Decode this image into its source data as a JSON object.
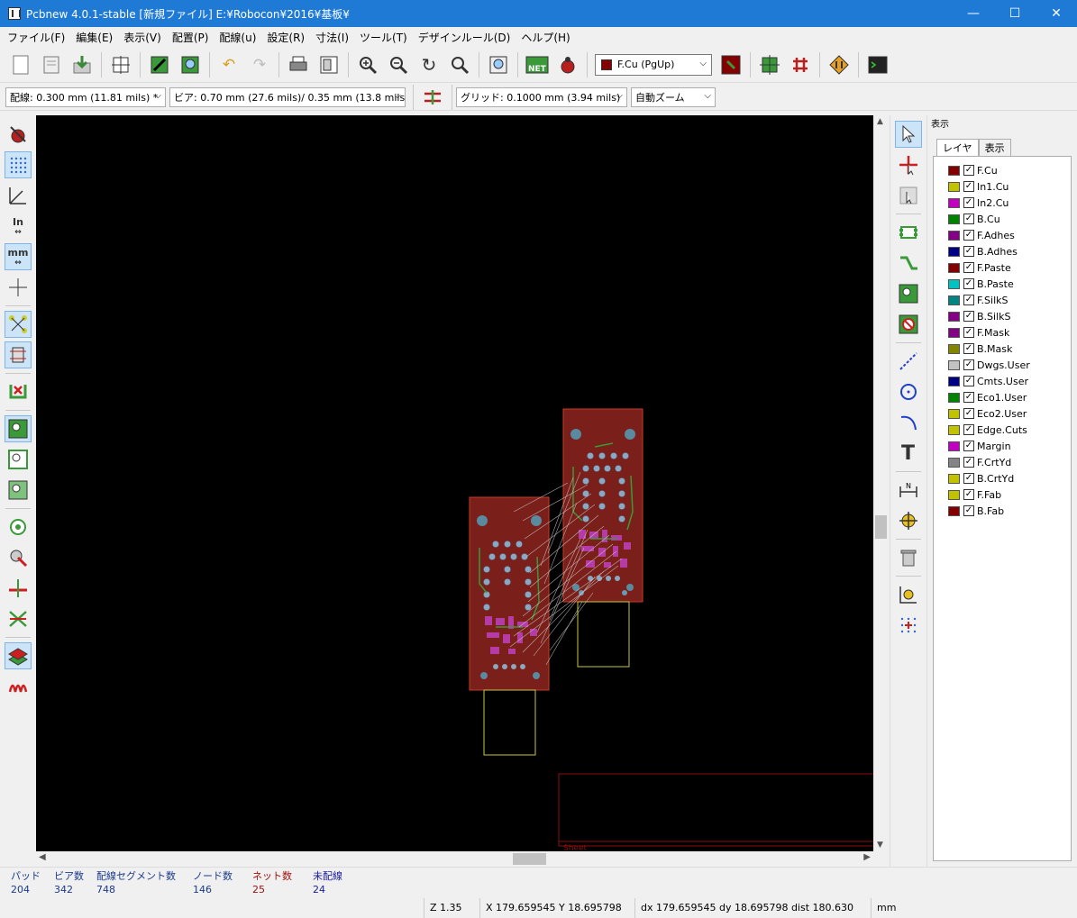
{
  "window": {
    "title": "Pcbnew 4.0.1-stable  [新規ファイル] E:¥Robocon¥2016¥基板¥",
    "minimize": "—",
    "maximize": "☐",
    "close": "✕"
  },
  "menu": [
    "ファイル(F)",
    "編集(E)",
    "表示(V)",
    "配置(P)",
    "配線(u)",
    "設定(R)",
    "寸法(I)",
    "ツール(T)",
    "デザインルール(D)",
    "ヘルプ(H)"
  ],
  "toolbar": {
    "active_layer": "F.Cu (PgUp)",
    "active_layer_color": "#840000"
  },
  "options": {
    "track_width": "配線: 0.300 mm (11.81 mils) *",
    "via_size": "ビア: 0.70 mm (27.6 mils)/ 0.35 mm (13.8 mils) *",
    "grid": "グリッド: 0.1000 mm (3.94 mils)",
    "zoom": "自動ズーム"
  },
  "left_toolbar": {
    "inch_label": "In",
    "mm_label": "mm"
  },
  "canvas": {
    "sheet_label": "Sheet"
  },
  "panel": {
    "title": "表示",
    "tabs": [
      "レイヤ",
      "表示"
    ],
    "layers": [
      {
        "name": "F.Cu",
        "color": "#840000"
      },
      {
        "name": "In1.Cu",
        "color": "#c2c200"
      },
      {
        "name": "In2.Cu",
        "color": "#c200c2"
      },
      {
        "name": "B.Cu",
        "color": "#008400"
      },
      {
        "name": "F.Adhes",
        "color": "#840084"
      },
      {
        "name": "B.Adhes",
        "color": "#000084"
      },
      {
        "name": "F.Paste",
        "color": "#840000"
      },
      {
        "name": "B.Paste",
        "color": "#00c2c2"
      },
      {
        "name": "F.SilkS",
        "color": "#008484"
      },
      {
        "name": "B.SilkS",
        "color": "#840084"
      },
      {
        "name": "F.Mask",
        "color": "#840084"
      },
      {
        "name": "B.Mask",
        "color": "#848400"
      },
      {
        "name": "Dwgs.User",
        "color": "#c2c2c2"
      },
      {
        "name": "Cmts.User",
        "color": "#000084"
      },
      {
        "name": "Eco1.User",
        "color": "#008400"
      },
      {
        "name": "Eco2.User",
        "color": "#c2c200"
      },
      {
        "name": "Edge.Cuts",
        "color": "#c2c200"
      },
      {
        "name": "Margin",
        "color": "#c200c2"
      },
      {
        "name": "F.CrtYd",
        "color": "#848484"
      },
      {
        "name": "B.CrtYd",
        "color": "#c2c200"
      },
      {
        "name": "F.Fab",
        "color": "#c2c200"
      },
      {
        "name": "B.Fab",
        "color": "#840000"
      }
    ]
  },
  "status": {
    "pads_label": "パッド",
    "pads": "204",
    "vias_label": "ビア数",
    "vias": "342",
    "segments_label": "配線セグメント数",
    "segments": "748",
    "nodes_label": "ノード数",
    "nodes": "146",
    "nets_label": "ネット数",
    "nets": "25",
    "unrouted_label": "未配線",
    "unrouted": "24",
    "zoom": "Z 1.35",
    "xy": "X 179.659545  Y 18.695798",
    "dxy": "dx 179.659545  dy 18.695798  dist 180.630",
    "units": "mm"
  }
}
